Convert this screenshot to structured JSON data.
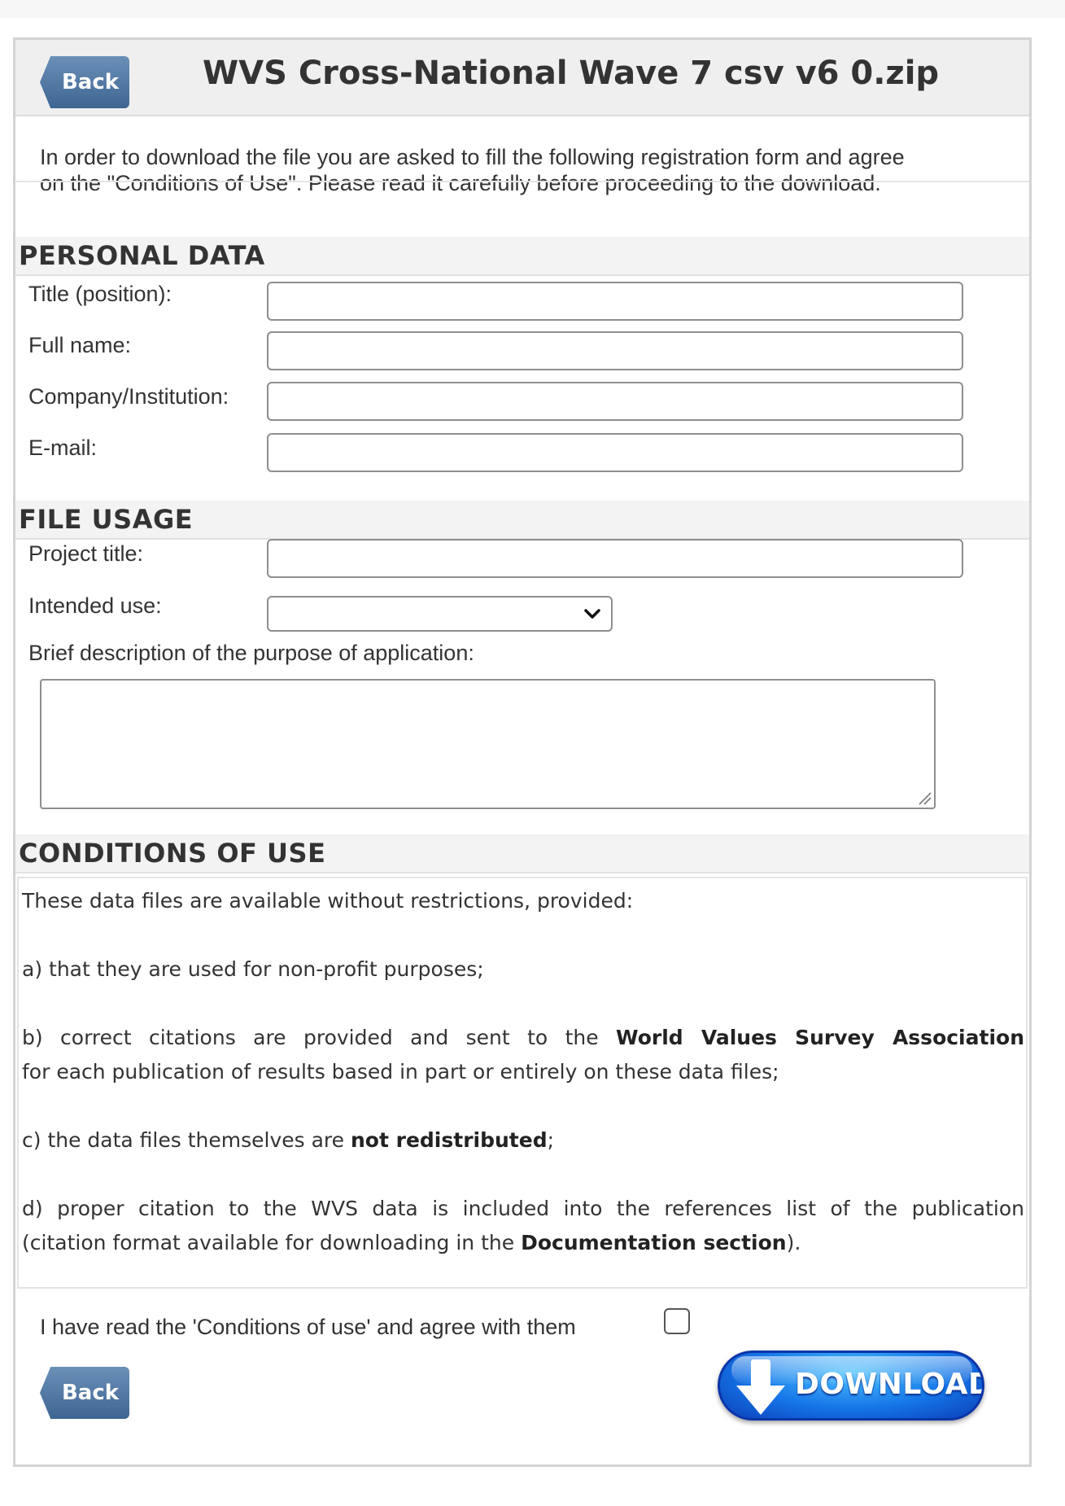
{
  "header": {
    "back_label": "Back",
    "title": "WVS Cross-National Wave 7 csv v6 0.zip"
  },
  "intro": {
    "line1": "In order to download the file you are asked to fill the following registration form and agree",
    "line2": "on the \"Conditions of Use\". Please read it carefully before proceeding to the download."
  },
  "personal": {
    "heading": "PERSONAL DATA",
    "fields": [
      {
        "label": "Title (position):",
        "value": ""
      },
      {
        "label": "Full name:",
        "value": ""
      },
      {
        "label": "Company/Institution:",
        "value": ""
      },
      {
        "label": "E-mail:",
        "value": ""
      }
    ]
  },
  "usage": {
    "heading": "FILE USAGE",
    "project_title_label": "Project title:",
    "project_title_value": "",
    "intended_use_label": "Intended use:",
    "intended_use_value": "",
    "description_label": "Brief description of the purpose of application:",
    "description_value": ""
  },
  "conditions": {
    "heading": "CONDITIONS OF USE",
    "intro": "These data files are available without restrictions, provided:",
    "a": "a) that they are used for non-profit purposes;",
    "b_pre": "b) correct citations are provided and sent to the ",
    "b_bold": "World Values Survey Association",
    "b_line2": "for each publication of results based in part or entirely on these data files;",
    "c_pre": "c) the data files themselves are ",
    "c_bold": "not redistributed",
    "c_post": ";",
    "d_line1": "d) proper citation to the WVS data is included into the references list of the publication",
    "d_pre": "(citation format available for downloading in the ",
    "d_bold": "Documentation section",
    "d_post": ")."
  },
  "agreement": {
    "label": "I have read the 'Conditions of use' and agree with them",
    "checked": false
  },
  "footer": {
    "back_label": "Back",
    "download_label": "DOWNLOAD"
  },
  "colors": {
    "back_button": "#4a6f99",
    "download_button": "#1576e8",
    "panel_border": "#d3d3d3"
  }
}
